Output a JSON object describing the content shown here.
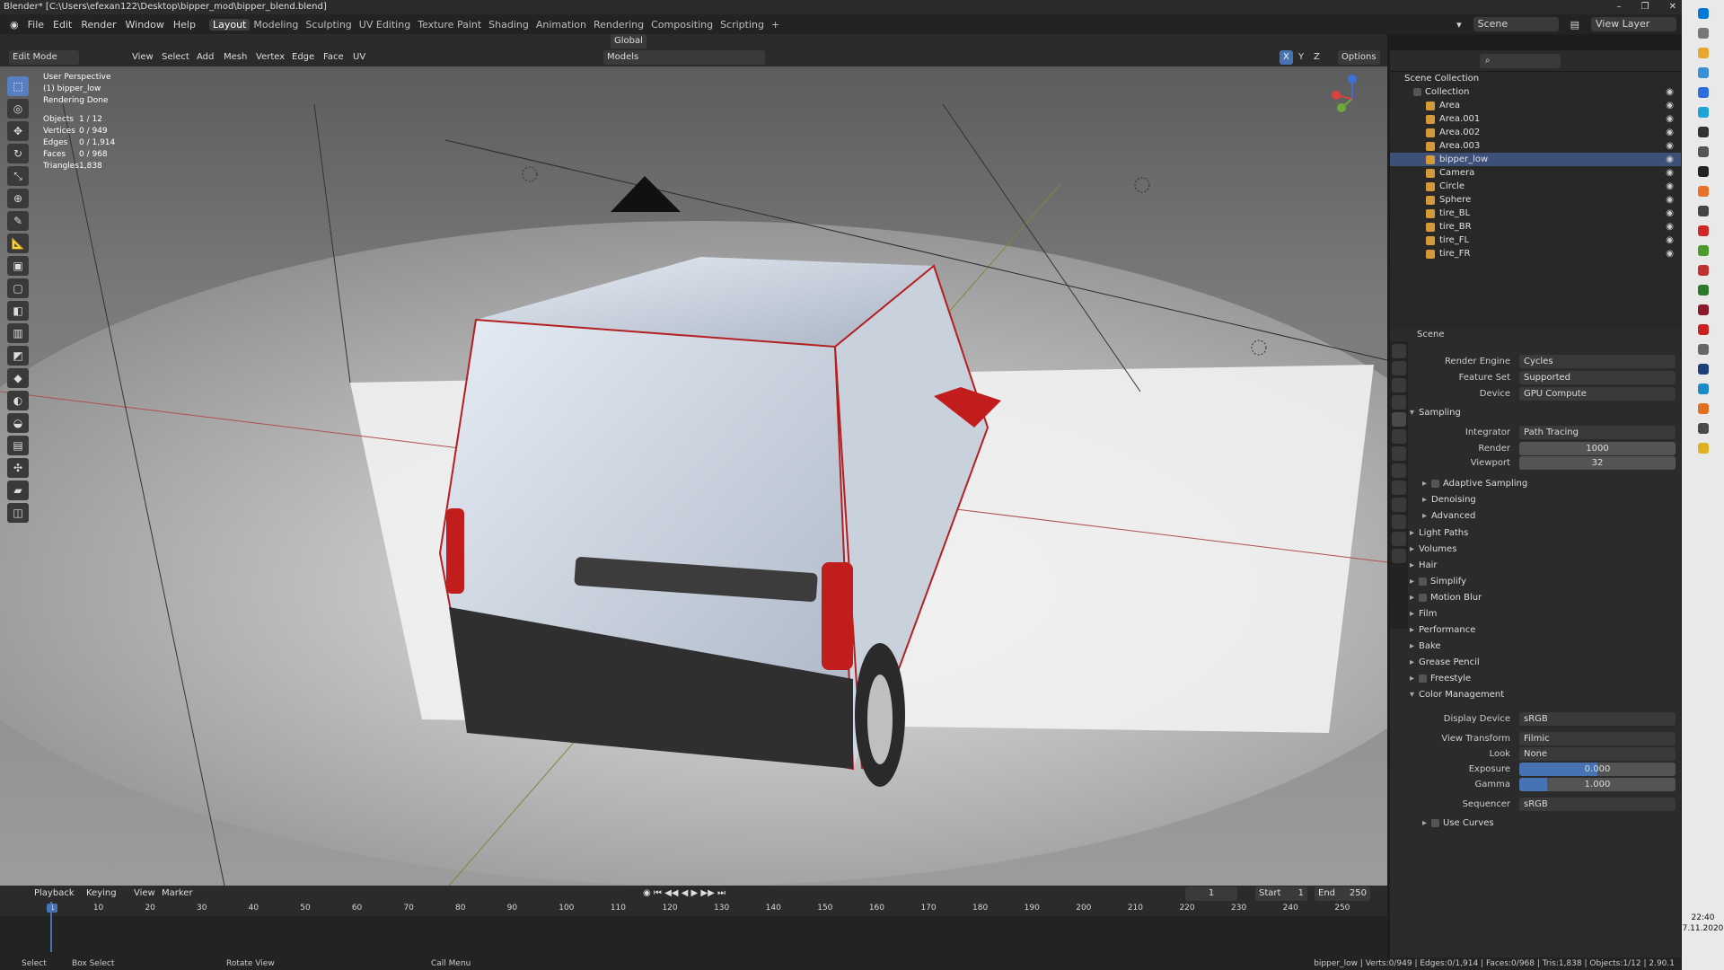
{
  "titlebar": {
    "title": "Blender* [C:\\Users\\efexan122\\Desktop\\bipper_mod\\bipper_blend.blend]"
  },
  "menu": {
    "items": [
      "File",
      "Edit",
      "Render",
      "Window",
      "Help"
    ],
    "workspaces": [
      "Layout",
      "Modeling",
      "Sculpting",
      "UV Editing",
      "Texture Paint",
      "Shading",
      "Animation",
      "Rendering",
      "Compositing",
      "Scripting",
      "+"
    ],
    "scene": "Scene",
    "view_layer": "View Layer"
  },
  "viewport_header": {
    "mode": "Edit Mode",
    "menus": [
      "View",
      "Select",
      "Add",
      "Mesh",
      "Vertex",
      "Edge",
      "Face",
      "UV"
    ],
    "orientation": "Global",
    "options": "Options",
    "collection": "Models",
    "axes": [
      "X",
      "Y",
      "Z"
    ]
  },
  "overlay": {
    "perspective": "User Perspective",
    "object": "(1) bipper_low",
    "status": "Rendering Done",
    "stats": [
      {
        "k": "Objects",
        "v": "1 / 12"
      },
      {
        "k": "Vertices",
        "v": "0 / 949"
      },
      {
        "k": "Edges",
        "v": "0 / 1,914"
      },
      {
        "k": "Faces",
        "v": "0 / 968"
      },
      {
        "k": "Triangles",
        "v": "1,838"
      }
    ]
  },
  "outliner": {
    "root": "Scene Collection",
    "collection": "Collection",
    "items": [
      "Area",
      "Area.001",
      "Area.002",
      "Area.003",
      "bipper_low",
      "Camera",
      "Circle",
      "Sphere",
      "tire_BL",
      "tire_BR",
      "tire_FL",
      "tire_FR"
    ],
    "selected": "bipper_low"
  },
  "properties": {
    "context": "Scene",
    "render_engine": {
      "label": "Render Engine",
      "value": "Cycles"
    },
    "feature_set": {
      "label": "Feature Set",
      "value": "Supported"
    },
    "device": {
      "label": "Device",
      "value": "GPU Compute"
    },
    "sampling": "Sampling",
    "integrator": {
      "label": "Integrator",
      "value": "Path Tracing"
    },
    "render": {
      "label": "Render",
      "value": "1000"
    },
    "viewport": {
      "label": "Viewport",
      "value": "32"
    },
    "sub": [
      "Adaptive Sampling",
      "Denoising",
      "Advanced"
    ],
    "sections": [
      "Light Paths",
      "Volumes",
      "Hair",
      "Simplify",
      "Motion Blur",
      "Film",
      "Performance",
      "Bake",
      "Grease Pencil",
      "Freestyle",
      "Color Management"
    ],
    "display_device": {
      "label": "Display Device",
      "value": "sRGB"
    },
    "view_transform": {
      "label": "View Transform",
      "value": "Filmic"
    },
    "look": {
      "label": "Look",
      "value": "None"
    },
    "exposure": {
      "label": "Exposure",
      "value": "0.000",
      "fill": 0.5
    },
    "gamma": {
      "label": "Gamma",
      "value": "1.000",
      "fill": 0.18
    },
    "sequencer": {
      "label": "Sequencer",
      "value": "sRGB"
    },
    "use_curves": "Use Curves"
  },
  "timeline": {
    "menus": [
      "Playback",
      "Keying",
      "View",
      "Marker"
    ],
    "current": "1",
    "start_label": "Start",
    "start": "1",
    "end_label": "End",
    "end": "250",
    "ticks": [
      "1",
      "10",
      "20",
      "30",
      "40",
      "50",
      "60",
      "70",
      "80",
      "90",
      "100",
      "110",
      "120",
      "130",
      "140",
      "150",
      "160",
      "170",
      "180",
      "190",
      "200",
      "210",
      "220",
      "230",
      "240",
      "250"
    ]
  },
  "status": {
    "select": "Select",
    "box": "Box Select",
    "rotate": "Rotate View",
    "call": "Call Menu",
    "info": "bipper_low | Verts:0/949 | Edges:0/1,914 | Faces:0/968 | Tris:1,838 | Objects:1/12 | 2.90.1"
  },
  "clock": {
    "time": "22:40",
    "date": "7.11.2020"
  }
}
